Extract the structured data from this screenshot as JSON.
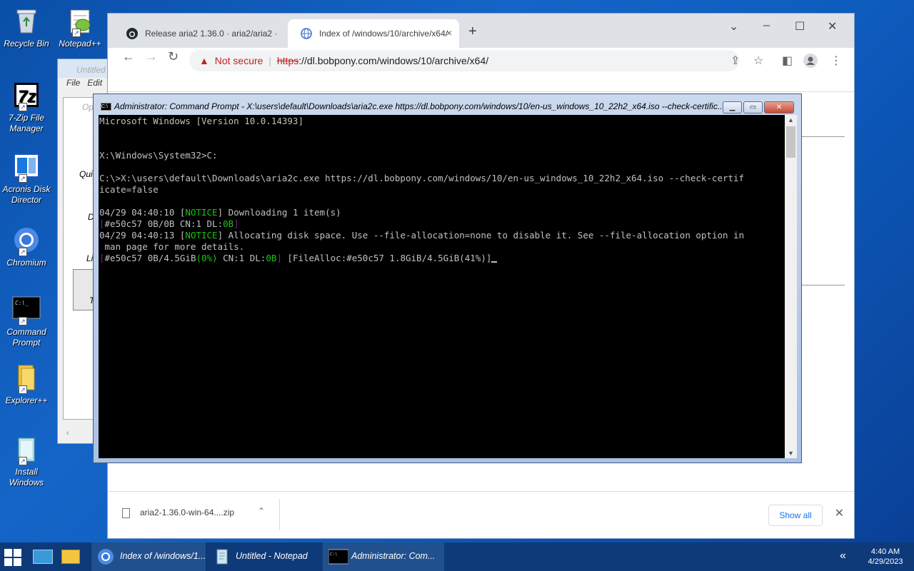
{
  "desktop": {
    "icons": [
      {
        "label": "Recycle Bin"
      },
      {
        "label": "Notepad++"
      },
      {
        "label": "7-Zip File Manager"
      },
      {
        "label": "Acronis Disk Director"
      },
      {
        "label": "Chromium"
      },
      {
        "label": "Command Prompt"
      },
      {
        "label": "Explorer++"
      },
      {
        "label": "Install Windows"
      }
    ]
  },
  "notepad_back": {
    "title": "Untitled",
    "menu": [
      "File",
      "Edit"
    ],
    "dialog_title": "Op",
    "dialog_fragments": [
      "Qui",
      "D",
      "Li",
      "T"
    ]
  },
  "chrome": {
    "tabs": [
      {
        "title": "Release aria2 1.36.0 · aria2/aria2 ·",
        "close": "×"
      },
      {
        "title": "Index of /windows/10/archive/x64/",
        "close": "×"
      }
    ],
    "new_tab": "+",
    "omnibox": {
      "security_label": "Not secure",
      "scheme": "https",
      "url_rest": "://dl.bobpony.com/windows/10/archive/x64/"
    },
    "download_shelf": {
      "file_name": "aria2-1.36.0-win-64....zip",
      "show_all_label": "Show all"
    }
  },
  "cmd": {
    "title": "Administrator: Command Prompt - X:\\users\\default\\Downloads\\aria2c.exe  https://dl.bobpony.com/windows/10/en-us_windows_10_22h2_x64.iso --check-certific...",
    "lines": {
      "l1": "Microsoft Windows [Version 10.0.14393]",
      "l2": "X:\\Windows\\System32>C:",
      "l3": "C:\\>X:\\users\\default\\Downloads\\aria2c.exe https://dl.bobpony.com/windows/10/en-us_windows_10_22h2_x64.iso --check-certif",
      "l4": "icate=false",
      "n1_time": "04/29 04:40:10 ",
      "n1_tag": "NOTICE",
      "n1_msg": " Downloading 1 item(s)",
      "p1_id": "#e50c57 0B/0B CN:1 DL:",
      "p1_dl": "0B",
      "n2_time": "04/29 04:40:13 ",
      "n2_tag": "NOTICE",
      "n2_msg": " Allocating disk space. Use --file-allocation=none to disable it. See --file-allocation option in",
      "n2_cont": " man page for more details.",
      "p2_id": "#e50c57 0B/4.5GiB",
      "p2_pct": "(0%)",
      "p2_cn": " CN:1 DL:",
      "p2_dl": "0B",
      "p2_alloc": " [FileAlloc:#e50c57 1.8GiB/4.5GiB(41%)]"
    }
  },
  "taskbar": {
    "buttons": [
      {
        "label": "Index of /windows/1..."
      },
      {
        "label": "Untitled - Notepad"
      },
      {
        "label": "Administrator: Com..."
      }
    ],
    "clock_time": "4:40 AM",
    "clock_date": "4/29/2023"
  },
  "colors": {
    "console_green": "#16c60c",
    "console_purple": "#881798",
    "chrome_warning": "#c5221f",
    "link_blue": "#1a73e8"
  }
}
